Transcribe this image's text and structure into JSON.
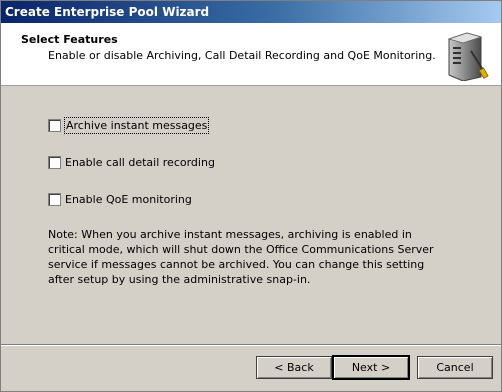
{
  "window": {
    "title": "Create Enterprise Pool Wizard"
  },
  "header": {
    "title": "Select Features",
    "description": "Enable or disable Archiving, Call Detail Recording and QoE Monitoring.",
    "icon": "server-wizard-icon"
  },
  "options": [
    {
      "label": "Archive instant messages",
      "checked": false,
      "focused": true
    },
    {
      "label": "Enable call detail recording",
      "checked": false
    },
    {
      "label": "Enable QoE monitoring",
      "checked": false
    }
  ],
  "note": "Note: When you archive instant messages, archiving is enabled in critical mode, which will shut down the Office Communications Server service if messages cannot be archived. You can change this setting after setup by using the administrative snap-in.",
  "buttons": {
    "back": "< Back",
    "next": "Next >",
    "cancel": "Cancel"
  }
}
